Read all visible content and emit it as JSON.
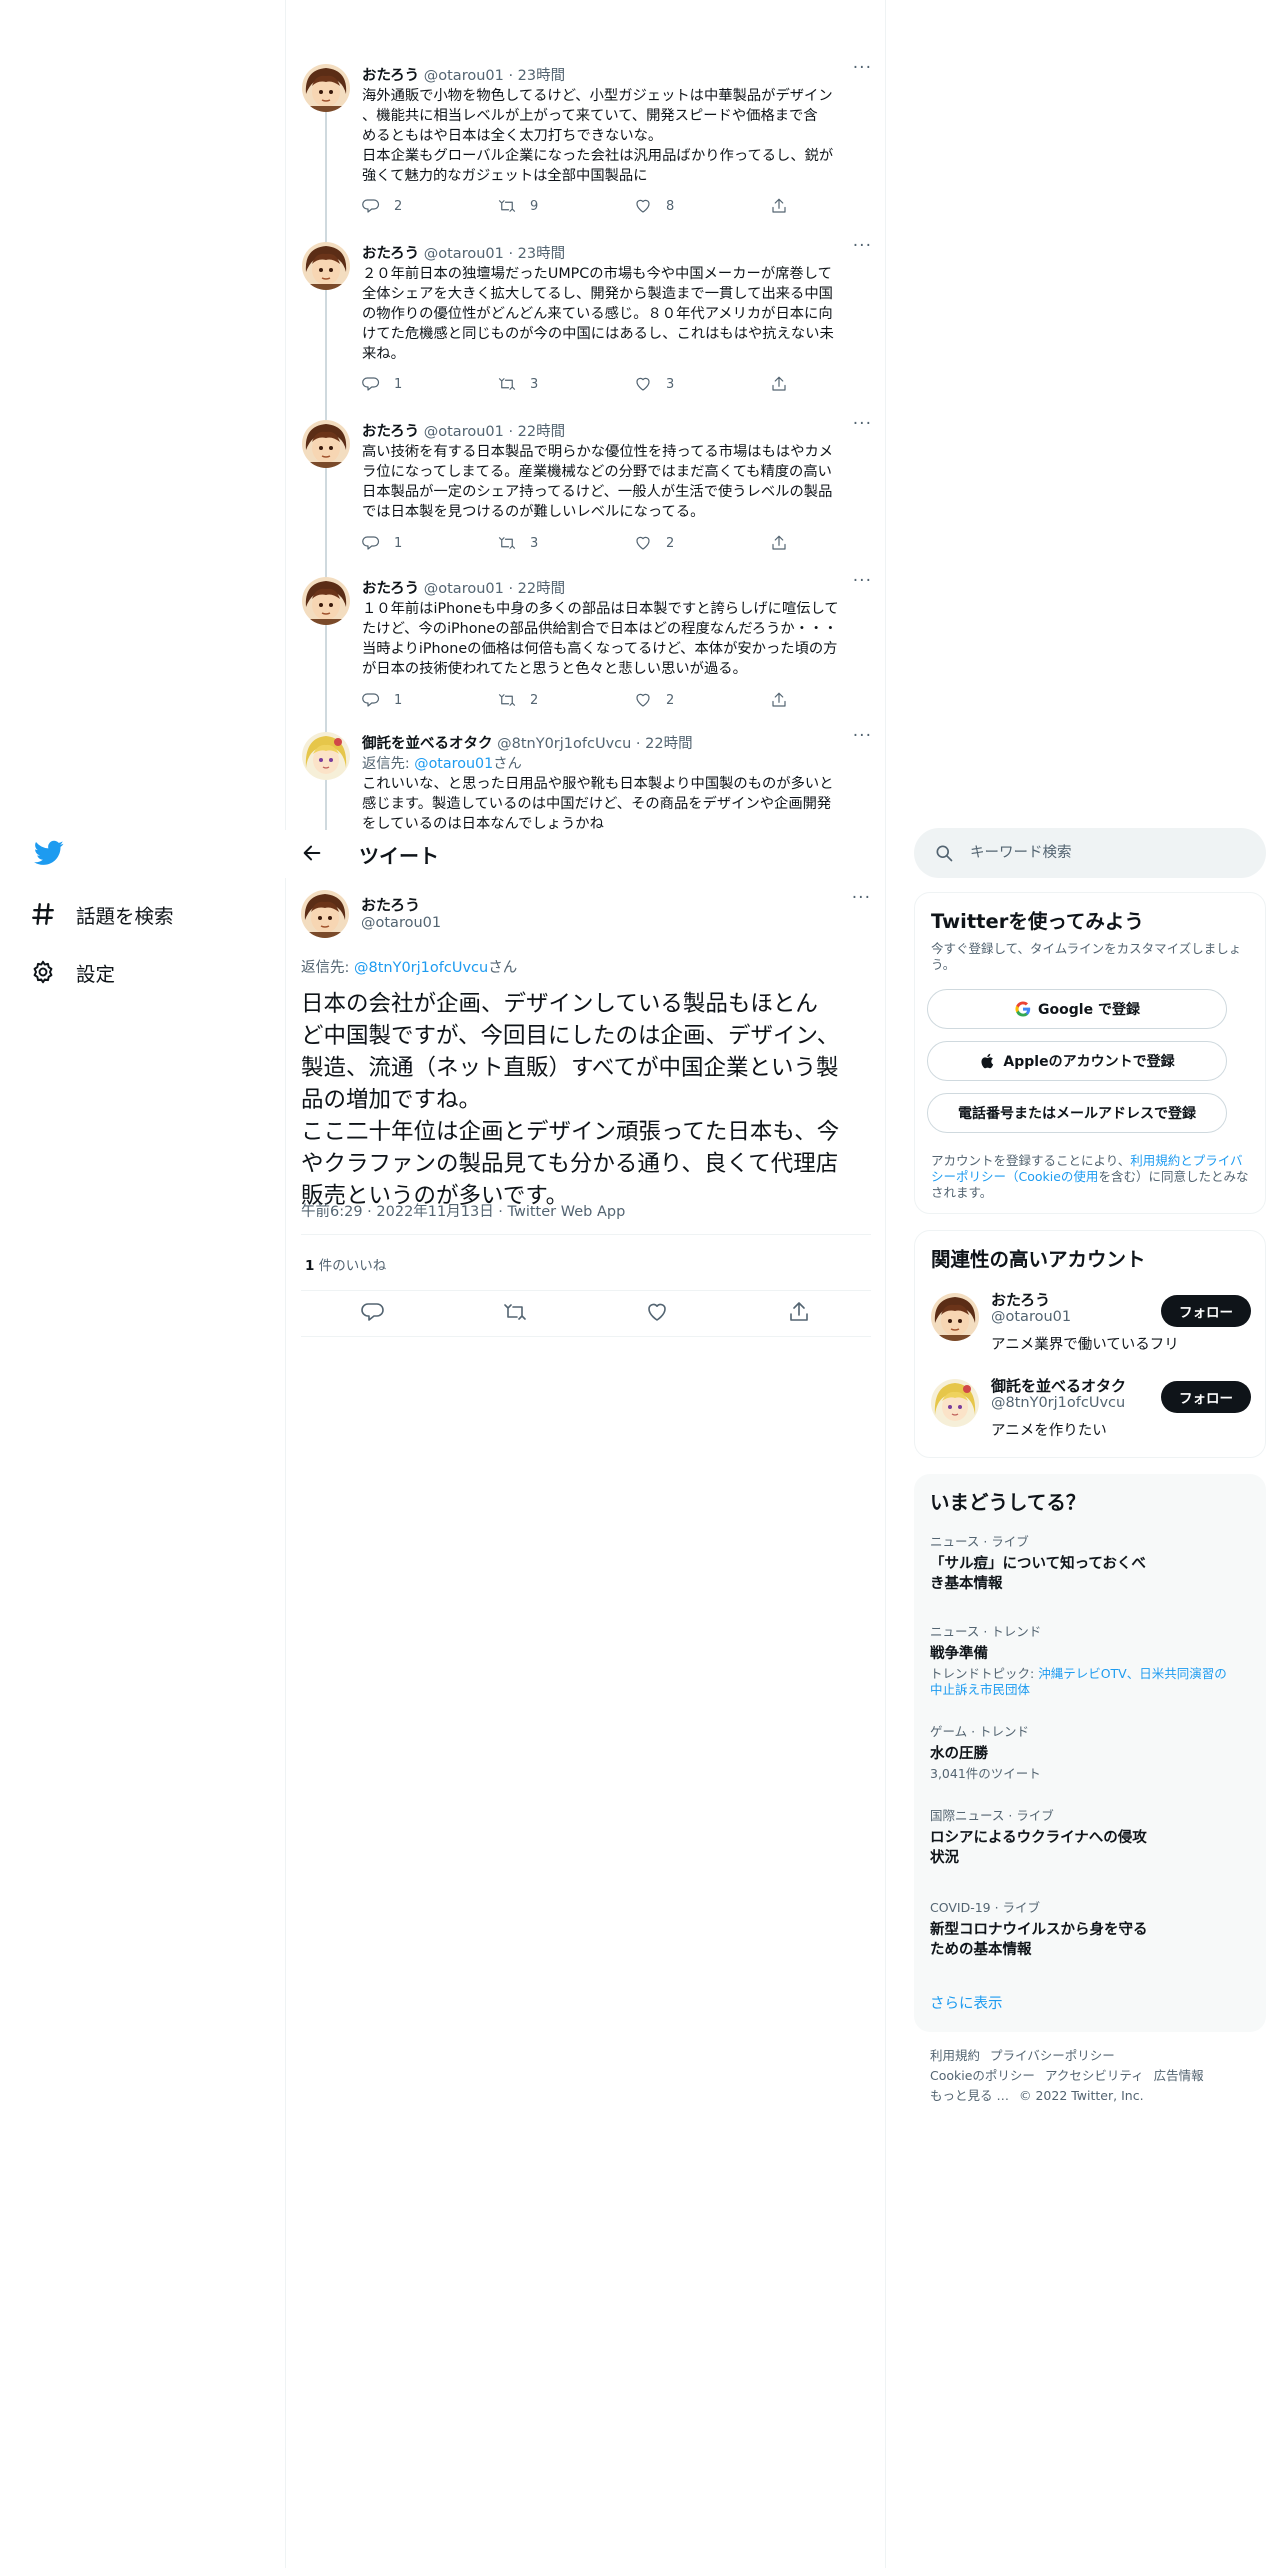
{
  "thread_tweets": [
    {
      "name": "おたろう",
      "meta": "@otarou01 · 23時間",
      "lines": [
        "海外通販で小物を物色してるけど、小型ガジェットは中華製品がデザイン",
        "、機能共に相当レベルが上がって来ていて、開発スピードや価格まで含",
        "めるともはや日本は全く太刀打ちできないな。",
        "日本企業もグローバル企業になった会社は汎用品ばかり作ってるし、鋭が",
        "強くて魅力的なガジェットは全部中国製品に"
      ],
      "reply_count": "2",
      "retweet_count": "9",
      "like_count": "8"
    },
    {
      "name": "おたろう",
      "meta": "@otarou01 · 23時間",
      "lines": [
        "２０年前日本の独壇場だったUMPCの市場も今や中国メーカーが席巻して",
        "全体シェアを大きく拡大してるし、開発から製造まで一貫して出来る中国",
        "の物作りの優位性がどんどん来ている感じ。８０年代アメリカが日本に向",
        "けてた危機感と同じものが今の中国にはあるし、これはもはや抗えない未",
        "来ね。"
      ],
      "reply_count": "1",
      "retweet_count": "3",
      "like_count": "3"
    },
    {
      "name": "おたろう",
      "meta": "@otarou01 · 22時間",
      "lines": [
        "高い技術を有する日本製品で明らかな優位性を持ってる市場はもはやカメ",
        "ラ位になってしまてる。産業機械などの分野ではまだ高くても精度の高い",
        "日本製品が一定のシェア持ってるけど、一般人が生活で使うレベルの製品",
        "では日本製を見つけるのが難しいレベルになってる。"
      ],
      "reply_count": "1",
      "retweet_count": "3",
      "like_count": "2"
    },
    {
      "name": "おたろう",
      "meta": "@otarou01 · 22時間",
      "lines": [
        "１０年前はiPhoneも中身の多くの部品は日本製ですと誇らしげに喧伝して",
        "たけど、今のiPhoneの部品供給割合で日本はどの程度なんだろうか・・・",
        "当時よりiPhoneの価格は何倍も高くなってるけど、本体が安かった頃の方",
        "が日本の技術使われてたと思うと色々と悲しい思いが過る。"
      ],
      "reply_count": "1",
      "retweet_count": "2",
      "like_count": "2"
    },
    {
      "name": "御託を並べるオタク",
      "meta": "@8tnY0rj1ofcUvcu · 22時間",
      "reply_prefix": "返信先: ",
      "reply_handle": "@otarou01",
      "reply_suffix": "さん",
      "lines": [
        "これいいな、と思った日用品や服や靴も日本製より中国製のものが多いと",
        "感じます。製造しているのは中国だけど、その商品をデザインや企画開発",
        "をしているのは日本なんでしょうかね"
      ]
    }
  ],
  "nav": {
    "explore_label": "話題を検索",
    "settings_label": "設定"
  },
  "header": {
    "title": "ツイート"
  },
  "main_tweet": {
    "name": "おたろう",
    "handle": "@otarou01",
    "reply_prefix": "返信先: ",
    "reply_handle": "@8tnY0rj1ofcUvcu",
    "reply_suffix": "さん",
    "lines": [
      "日本の会社が企画、デザインしている製品もほとん",
      "ど中国製ですが、今回目にしたのは企画、デザイン、",
      "製造、流通（ネット直販）すべてが中国企業という製",
      "品の増加ですね。",
      "ここ二十年位は企画とデザイン頑張ってた日本も、今",
      "やクラファンの製品見ても分かる通り、良くて代理店",
      "販売というのが多いです。"
    ],
    "timestamp": "午前6:29 · 2022年11月13日 · Twitter Web App",
    "like_count": "1",
    "like_label": " 件のいいね"
  },
  "search": {
    "placeholder": "キーワード検索"
  },
  "signup": {
    "title": "Twitterを使ってみよう",
    "subtitle": "今すぐ登録して、タイムラインをカスタマイズしましょう。",
    "google_label": "Google で登録",
    "apple_label": "Appleのアカウントで登録",
    "phone_label": "電話番号またはメールアドレスで登録",
    "terms_prefix": "アカウントを登録することにより、",
    "terms_link": "利用規約とプライバシーポリシー（Cookieの使用",
    "terms_suffix": "を含む）に同意したとみなされます。"
  },
  "related": {
    "title": "関連性の高いアカウント",
    "accounts": [
      {
        "name": "おたろう",
        "handle": "@otarou01",
        "bio": "アニメ業界で働いているフリ",
        "follow_label": "フォロー"
      },
      {
        "name": "御託を並べるオタク",
        "handle": "@8tnY0rj1ofcUvcu",
        "bio": "アニメを作りたい",
        "follow_label": "フォロー"
      }
    ]
  },
  "trends": {
    "title": "いまどうしてる？",
    "items": [
      {
        "category": "ニュース · ライブ",
        "title_l1": "「サル痘」について知っておくべ",
        "title_l2": "き基本情報"
      },
      {
        "category": "ニュース · トレンド",
        "title_l1": "戦争準備",
        "topic_prefix": "トレンドトピック: ",
        "topic_link_l1": "沖縄テレビOTV、日米共同演習の",
        "topic_link_l2": "中止訴え市民団体"
      },
      {
        "category": "ゲーム · トレンド",
        "title_l1": "水の圧勝",
        "meta": "3,041件のツイート"
      },
      {
        "category": "国際ニュース · ライブ",
        "title_l1": "ロシアによるウクライナへの侵攻",
        "title_l2": "状況"
      },
      {
        "category": "COVID-19 · ライブ",
        "title_l1": "新型コロナウイルスから身を守る",
        "title_l2": "ための基本情報"
      }
    ],
    "show_more": "さらに表示"
  },
  "footer": {
    "terms": "利用規約",
    "privacy": "プライバシーポリシー",
    "cookie": "Cookieのポリシー",
    "accessibility": "アクセシビリティ",
    "ads": "広告情報",
    "more": "もっと見る …",
    "copyright": "© 2022 Twitter, Inc."
  },
  "colors": {
    "brand": "#1d9bf0",
    "text": "#0f1419",
    "muted": "#536471",
    "border": "#eff3f4"
  }
}
